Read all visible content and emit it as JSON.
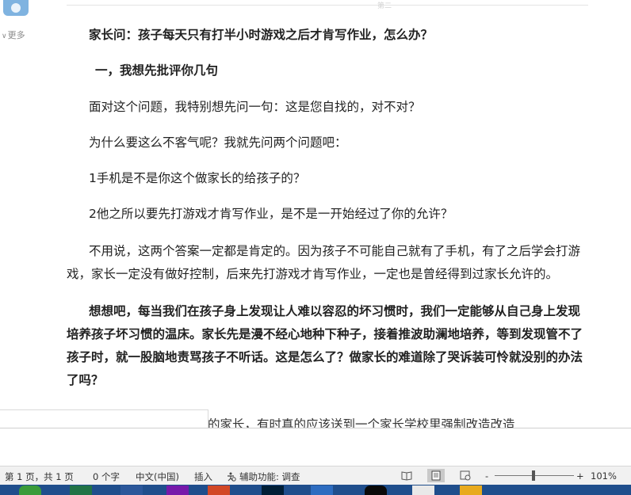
{
  "sidebar": {
    "more_label": "更多",
    "more_arrow": "∨"
  },
  "page": {
    "label": "第二"
  },
  "document": {
    "title": "家长问：孩子每天只有打半小时游戏之后才肯写作业，怎么办？",
    "heading": "一，我想先批评你几句",
    "p1": "面对这个问题，我特别想先问一句：这是您自找的，对不对？",
    "p2": "为什么要这么不客气呢？我就先问两个问题吧：",
    "p3": "1手机是不是你这个做家长的给孩子的？",
    "p4": "2他之所以要先打游戏才肯写作业，是不是一开始经过了你的允许？",
    "p5": "不用说，这两个答案一定都是肯定的。因为孩子不可能自己就有了手机，有了之后学会打游戏，家长一定没有做好控制，后来先打游戏才肯写作业，一定也是曾经得到过家长允许的。",
    "p6": "想想吧，每当我们在孩子身上发现让人难以容忍的坏习惯时，我们一定能够从自己身上发现培养孩子坏习惯的温床。家长先是漫不经心地种下种子，接着推波助澜地培养，等到发现管不了孩子时，就一股脑地责骂孩子不听话。这是怎么了？做家长的难道除了哭诉装可怜就没别的办法了吗？",
    "p7_partial": "的家长，有时真的应该送到一个家长学校里强制改造改造"
  },
  "statusbar": {
    "page_info": "第 1 页，共 1 页",
    "word_count": "0 个字",
    "language": "中文(中国)",
    "insert_mode": "插入",
    "accessibility": "辅助功能: 调查",
    "zoom_minus": "-",
    "zoom_plus": "+",
    "zoom_level": "101%"
  },
  "colors": {
    "taskbar": "#1f4e8c",
    "statusbar": "#f1f1f1",
    "avatar": "#7fb3e0"
  },
  "icons": [
    "avatar-icon",
    "accessibility-icon",
    "read-mode-icon",
    "print-layout-icon",
    "web-layout-icon"
  ]
}
